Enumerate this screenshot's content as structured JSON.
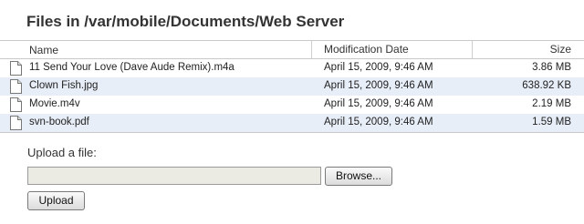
{
  "page": {
    "title": "Files in /var/mobile/Documents/Web Server"
  },
  "table": {
    "columns": {
      "name": "Name",
      "date": "Modification Date",
      "size": "Size"
    },
    "rows": [
      {
        "name": "11 Send Your Love (Dave Aude Remix).m4a",
        "date": "April 15, 2009, 9:46 AM",
        "size": "3.86 MB",
        "icon": "document-icon"
      },
      {
        "name": "Clown Fish.jpg",
        "date": "April 15, 2009, 9:46 AM",
        "size": "638.92 KB",
        "icon": "document-icon"
      },
      {
        "name": "Movie.m4v",
        "date": "April 15, 2009, 9:46 AM",
        "size": "2.19 MB",
        "icon": "document-icon"
      },
      {
        "name": "svn-book.pdf",
        "date": "April 15, 2009, 9:46 AM",
        "size": "1.59 MB",
        "icon": "document-icon"
      }
    ],
    "alt_row_color": "#e8eef8"
  },
  "upload": {
    "label": "Upload a file:",
    "file_value": "",
    "browse_label": "Browse...",
    "upload_label": "Upload"
  }
}
